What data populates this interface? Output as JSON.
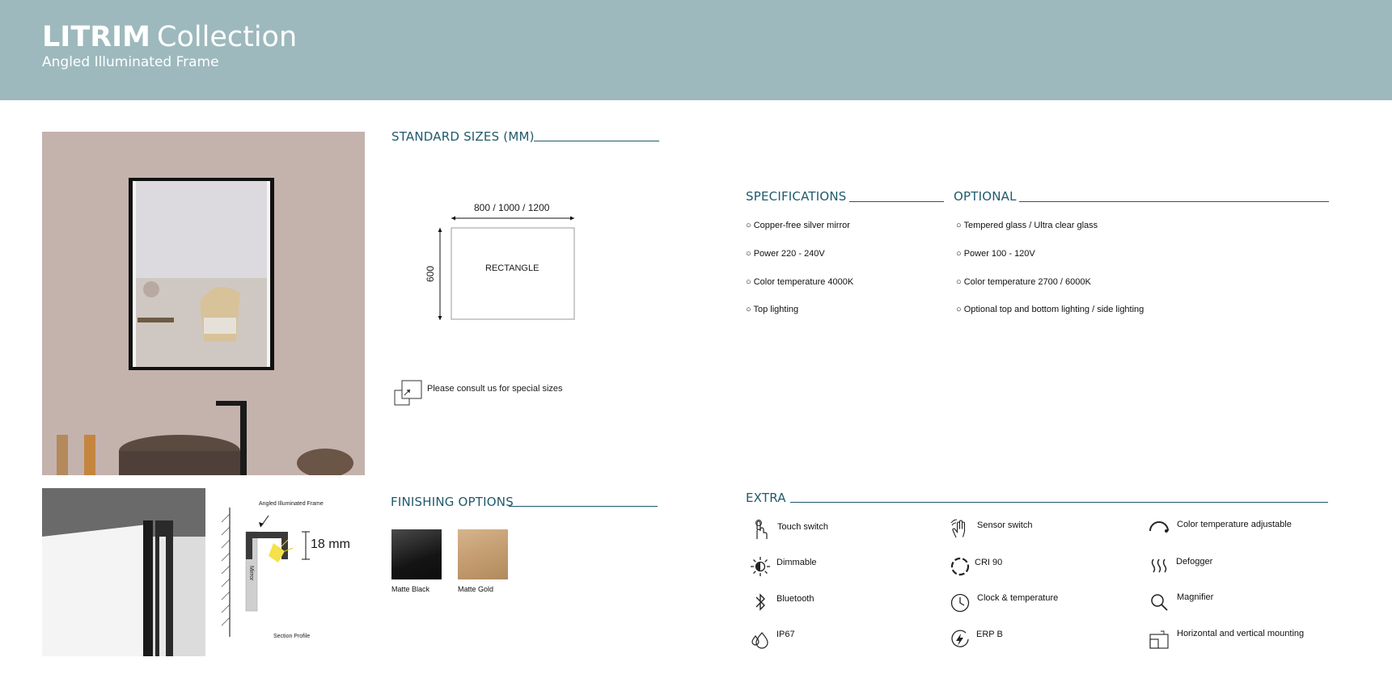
{
  "header": {
    "brand_bold": "LITRIM",
    "brand_light": "Collection",
    "subtitle": "Angled Illuminated Frame"
  },
  "standard_sizes": {
    "title": "STANDARD SIZES (MM)",
    "width_label": "800 / 1000 / 1200",
    "height_label": "600",
    "shape_label": "RECTANGLE",
    "special_note": "Please consult us for special sizes"
  },
  "section_profile": {
    "frame_label": "Angled Illuminated Frame",
    "depth_label": "18 mm",
    "mirror_label": "Mirror",
    "caption": "Section Profile"
  },
  "finishing": {
    "title": "FINISHING OPTIONS",
    "options": [
      {
        "label": "Matte Black",
        "color": "#1e1e1e"
      },
      {
        "label": "Matte Gold",
        "color": "#c9a47a"
      }
    ]
  },
  "specifications": {
    "title": "SPECIFICATIONS",
    "items": [
      "○ Copper-free silver mirror",
      "○ Power 220 - 240V",
      "○ Color temperature 4000K",
      "○ Top lighting"
    ]
  },
  "optional": {
    "title": "OPTIONAL",
    "items": [
      "○ Tempered glass / Ultra clear glass",
      "○ Power 100 - 120V",
      "○ Color temperature 2700 / 6000K",
      "○ Optional top and bottom lighting / side lighting"
    ]
  },
  "extra": {
    "title": "EXTRA",
    "items": [
      {
        "label": "Touch switch",
        "icon": "touch-icon"
      },
      {
        "label": "Sensor switch",
        "icon": "sensor-icon"
      },
      {
        "label": "Color temperature adjustable",
        "icon": "color-temp-icon"
      },
      {
        "label": "Dimmable",
        "icon": "dimmable-icon"
      },
      {
        "label": "CRI 90",
        "icon": "cri-icon"
      },
      {
        "label": "Defogger",
        "icon": "defogger-icon"
      },
      {
        "label": "Bluetooth",
        "icon": "bluetooth-icon"
      },
      {
        "label": "Clock & temperature",
        "icon": "clock-icon"
      },
      {
        "label": "Magnifier",
        "icon": "magnifier-icon"
      },
      {
        "label": "IP67",
        "icon": "ip67-icon"
      },
      {
        "label": "ERP B",
        "icon": "erp-icon"
      },
      {
        "label": "Horizontal and vertical mounting",
        "icon": "mounting-icon"
      }
    ]
  },
  "colors": {
    "header_bg": "#9db9bd",
    "accent": "#1f5a6c"
  }
}
